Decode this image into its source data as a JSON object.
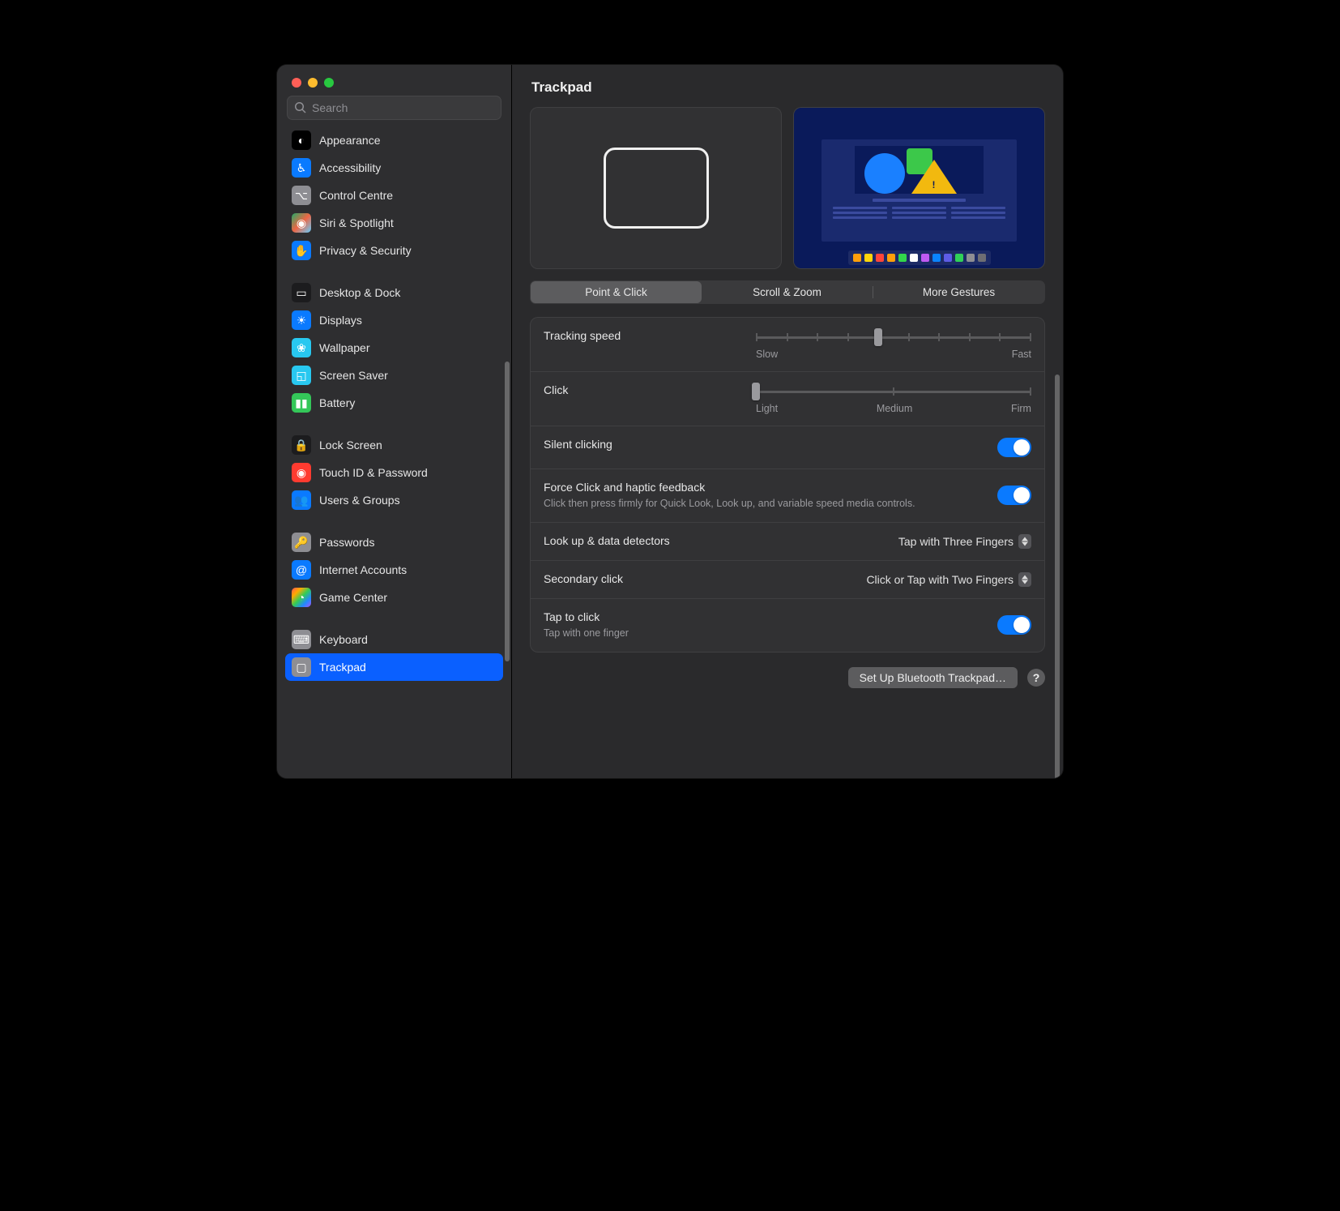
{
  "header": {
    "title": "Trackpad"
  },
  "search": {
    "placeholder": "Search"
  },
  "sidebar": {
    "groups": [
      [
        {
          "id": "appearance",
          "label": "Appearance",
          "icon": "◐",
          "bg": "#000000"
        },
        {
          "id": "accessibility",
          "label": "Accessibility",
          "icon": "♿︎",
          "bg": "#0a7aff"
        },
        {
          "id": "control-centre",
          "label": "Control Centre",
          "icon": "⌥",
          "bg": "#8e8e93"
        },
        {
          "id": "siri-spotlight",
          "label": "Siri & Spotlight",
          "icon": "◉",
          "bg": "linear-gradient(135deg,#2a6,#e64,#6cf)"
        },
        {
          "id": "privacy",
          "label": "Privacy & Security",
          "icon": "✋",
          "bg": "#0a7aff"
        }
      ],
      [
        {
          "id": "desktop-dock",
          "label": "Desktop & Dock",
          "icon": "▭",
          "bg": "#1c1c1e"
        },
        {
          "id": "displays",
          "label": "Displays",
          "icon": "☀",
          "bg": "#0a7aff"
        },
        {
          "id": "wallpaper",
          "label": "Wallpaper",
          "icon": "❀",
          "bg": "#28c8f0"
        },
        {
          "id": "screen-saver",
          "label": "Screen Saver",
          "icon": "◱",
          "bg": "#28c8f0"
        },
        {
          "id": "battery",
          "label": "Battery",
          "icon": "▮▮",
          "bg": "#34c759"
        }
      ],
      [
        {
          "id": "lock-screen",
          "label": "Lock Screen",
          "icon": "🔒",
          "bg": "#1c1c1e"
        },
        {
          "id": "touch-id",
          "label": "Touch ID & Password",
          "icon": "◉",
          "bg": "#ff3b30"
        },
        {
          "id": "users-groups",
          "label": "Users & Groups",
          "icon": "👥",
          "bg": "#0a7aff"
        }
      ],
      [
        {
          "id": "passwords",
          "label": "Passwords",
          "icon": "🔑",
          "bg": "#8e8e93"
        },
        {
          "id": "internet-accounts",
          "label": "Internet Accounts",
          "icon": "@",
          "bg": "#0a7aff"
        },
        {
          "id": "game-center",
          "label": "Game Center",
          "icon": "◔",
          "bg": "linear-gradient(135deg,#f55,#fa0,#3c5,#28f,#a5f)"
        }
      ],
      [
        {
          "id": "keyboard",
          "label": "Keyboard",
          "icon": "⌨",
          "bg": "#8e8e93"
        },
        {
          "id": "trackpad",
          "label": "Trackpad",
          "icon": "▢",
          "bg": "#8e8e93",
          "selected": true
        }
      ]
    ]
  },
  "tabs": [
    "Point & Click",
    "Scroll & Zoom",
    "More Gestures"
  ],
  "active_tab_index": 0,
  "settings": {
    "tracking_speed": {
      "label": "Tracking speed",
      "ticks": 10,
      "value_index": 4,
      "min_label": "Slow",
      "max_label": "Fast"
    },
    "click": {
      "label": "Click",
      "ticks": 3,
      "value_index": 0,
      "left_label": "Light",
      "mid_label": "Medium",
      "right_label": "Firm"
    },
    "silent_clicking": {
      "label": "Silent clicking",
      "enabled": true
    },
    "force_click": {
      "label": "Force Click and haptic feedback",
      "desc": "Click then press firmly for Quick Look, Look up, and variable speed media controls.",
      "enabled": true
    },
    "look_up": {
      "label": "Look up & data detectors",
      "value": "Tap with Three Fingers"
    },
    "secondary_click": {
      "label": "Secondary click",
      "value": "Click or Tap with Two Fingers"
    },
    "tap_to_click": {
      "label": "Tap to click",
      "desc": "Tap with one finger",
      "enabled": true
    }
  },
  "footer": {
    "bluetooth_btn": "Set Up Bluetooth Trackpad…",
    "help": "?"
  },
  "dock_colors": [
    "#ff9f0a",
    "#ffd60a",
    "#ff453a",
    "#ff9f0a",
    "#32d74b",
    "#ffffff",
    "#bf5af2",
    "#0a84ff",
    "#5e5ce6",
    "#30d158",
    "#8e8e93",
    "#6e6e73"
  ]
}
